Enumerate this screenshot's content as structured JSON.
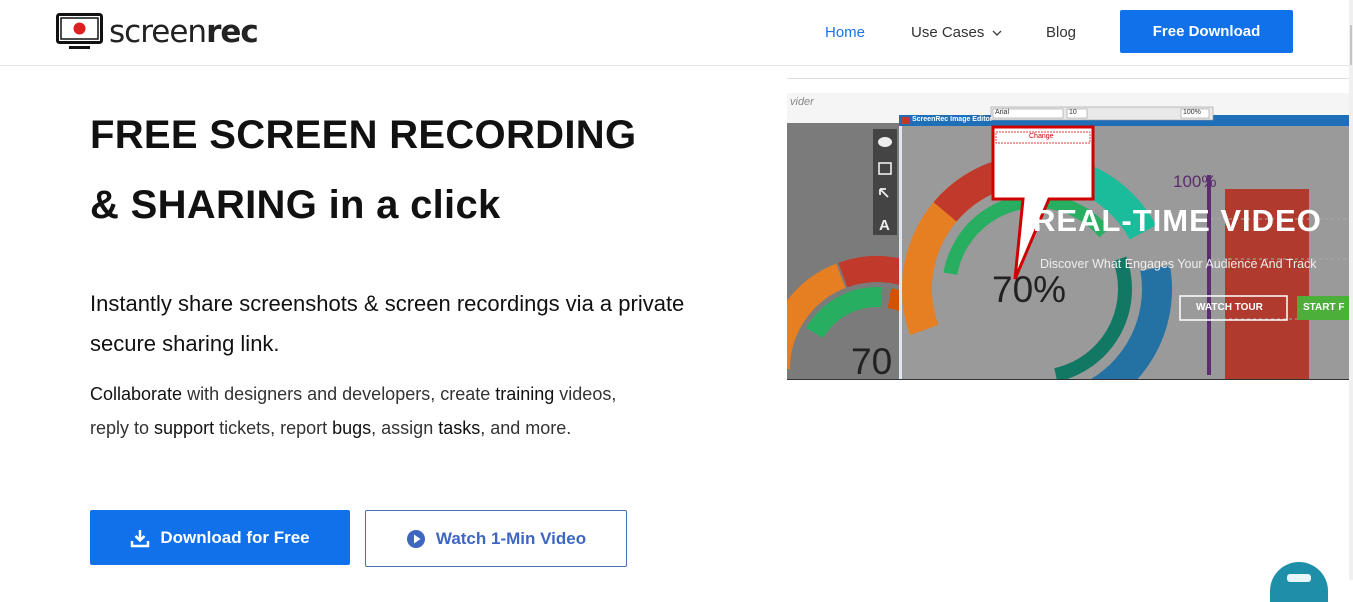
{
  "brand": {
    "word_light": "screen",
    "word_bold": "rec"
  },
  "nav": {
    "home": "Home",
    "use_cases": "Use Cases",
    "blog": "Blog",
    "download": "Free Download"
  },
  "hero": {
    "title_line1": "FREE SCREEN RECORDING",
    "title_line2_bold": "& SHARING",
    "title_line2_rest": " in a click",
    "subtitle": "Instantly share screenshots & screen recordings via a private secure sharing link.",
    "para": {
      "w1": "Collaborate",
      "t1": " with designers and developers, create ",
      "w2": "training",
      "t2": " videos, reply to ",
      "w3": "support",
      "t3": " tickets, report ",
      "w4": "bugs",
      "t4": ", assign ",
      "w5": "tasks",
      "t5": ", and more."
    },
    "btn_download": "Download for Free",
    "btn_watch": "Watch 1-Min Video"
  },
  "screenshot": {
    "vider": "vider",
    "editor_title": "ScreenRec Image Editor",
    "font_name": "Arial",
    "font_size": "10",
    "zoom": "100%",
    "change_label": "Change",
    "headline": "REAL-TIME VIDEO",
    "tagline": "Discover What Engages Your Audience And Track",
    "watch_tour": "WATCH TOUR",
    "start_free": "START F",
    "pct_70": "70%",
    "pct_70b": "70",
    "pct_100": "100%"
  },
  "colors": {
    "accent": "#1071ea",
    "nav_active": "#1a73e8",
    "record_red": "#e02020"
  }
}
